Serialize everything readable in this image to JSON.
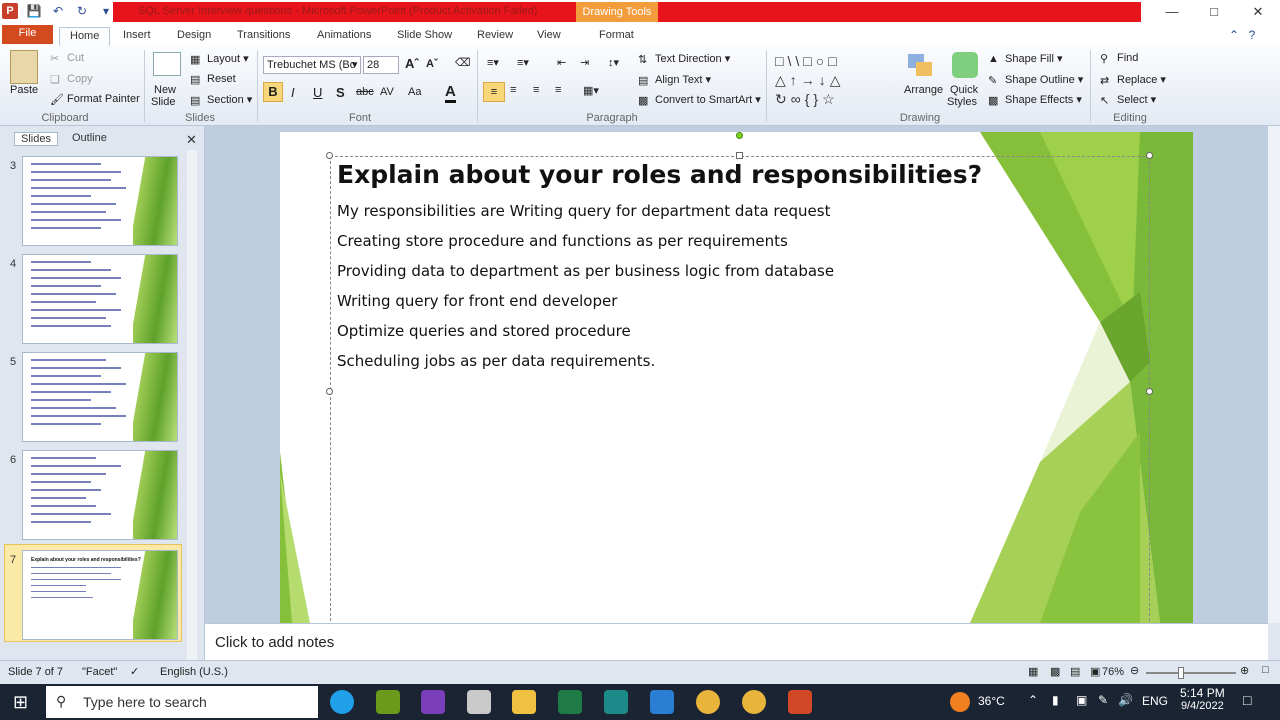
{
  "app": {
    "title": "SQL Server Interview questions - Microsoft PowerPoint (Product Activation Failed)",
    "context_tab": "Drawing Tools",
    "app_icon": "P"
  },
  "tabs": [
    "File",
    "Home",
    "Insert",
    "Design",
    "Transitions",
    "Animations",
    "Slide Show",
    "Review",
    "View",
    "Format"
  ],
  "ribbon": {
    "clipboard": {
      "paste": "Paste",
      "cut": "Cut",
      "copy": "Copy",
      "format_painter": "Format Painter",
      "label": "Clipboard"
    },
    "slides": {
      "new_slide": "New",
      "new_slide2": "Slide",
      "layout": "Layout",
      "reset": "Reset",
      "section": "Section",
      "label": "Slides"
    },
    "font": {
      "family": "Trebuchet MS (Bo",
      "size": "28",
      "label": "Font",
      "bold": "B",
      "italic": "I",
      "underline": "U",
      "shadow": "S",
      "strike": "abc",
      "spacing": "AV",
      "case": "Aa",
      "color": "A"
    },
    "paragraph": {
      "text_direction": "Text Direction",
      "align_text": "Align Text",
      "smartart": "Convert to SmartArt",
      "label": "Paragraph"
    },
    "drawing": {
      "arrange": "Arrange",
      "quick_styles": "Quick",
      "quick_styles2": "Styles",
      "shape_fill": "Shape Fill",
      "shape_outline": "Shape Outline",
      "shape_effects": "Shape Effects",
      "label": "Drawing"
    },
    "editing": {
      "find": "Find",
      "replace": "Replace",
      "select": "Select",
      "label": "Editing"
    }
  },
  "pane": {
    "tab_slides": "Slides",
    "tab_outline": "Outline",
    "thumbs": [
      {
        "num": "3"
      },
      {
        "num": "4"
      },
      {
        "num": "5"
      },
      {
        "num": "6"
      },
      {
        "num": "7",
        "title": "Explain about your roles and responsibilities?"
      }
    ]
  },
  "slide": {
    "title": "Explain about your roles and responsibilities?",
    "bullets": [
      "My responsibilities are Writing query for department data request",
      "Creating store procedure and functions as per requirements",
      "Providing data to department as per business logic from database",
      "Writing query for front end developer",
      "Optimize queries and stored procedure",
      "Scheduling jobs as per data requirements."
    ]
  },
  "notes": {
    "placeholder": "Click to add notes"
  },
  "status": {
    "slide": "Slide 7 of 7",
    "theme": "\"Facet\"",
    "language": "English (U.S.)",
    "zoom": "76%"
  },
  "taskbar": {
    "search_placeholder": "Type here to search",
    "temperature": "36°C",
    "lang": "ENG",
    "time": "5:14 PM",
    "date": "9/4/2022"
  },
  "colors": {
    "title_bar_strip": "#e8141b",
    "drawing_tools": "#f39c3c",
    "file_tab": "#d44a1f",
    "slide_green": "#7ab83a"
  }
}
